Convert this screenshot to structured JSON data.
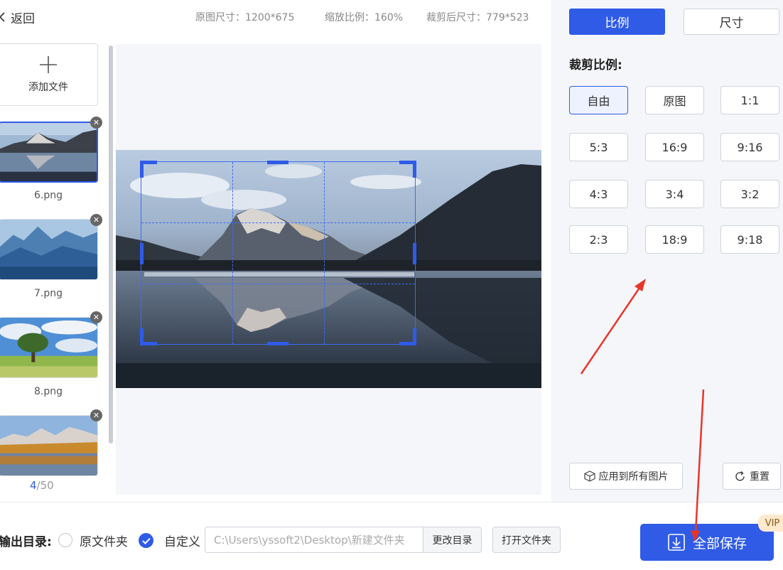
{
  "header": {
    "back_label": "返回",
    "original_size": "原图尺寸：1200*675",
    "zoom": "缩放比例：160%",
    "cropped_size": "裁剪后尺寸：779*523"
  },
  "files": {
    "add_label": "添加文件",
    "items": [
      {
        "name": "6.png",
        "active": true
      },
      {
        "name": "7.png",
        "active": false
      },
      {
        "name": "8.png",
        "active": false
      },
      {
        "name": "",
        "active": false
      }
    ],
    "counter_current": "4",
    "counter_total": "/50"
  },
  "panel": {
    "tab_ratio": "比例",
    "tab_size": "尺寸",
    "section_title": "裁剪比例:",
    "ratios": [
      "自由",
      "原图",
      "1:1",
      "5:3",
      "16:9",
      "9:16",
      "4:3",
      "3:4",
      "3:2",
      "2:3",
      "18:9",
      "9:18"
    ],
    "selected_ratio": "自由",
    "apply_all": "应用到所有图片",
    "reset": "重置"
  },
  "output": {
    "label": "输出目录:",
    "option_original": "原文件夹",
    "option_custom": "自定义",
    "selected": "custom",
    "path": "C:\\Users\\yssoft2\\Desktop\\新建文件夹",
    "change_dir": "更改目录",
    "open_folder": "打开文件夹",
    "save_all": "全部保存",
    "vip_badge": "VIP"
  },
  "colors": {
    "accent": "#2f5be7",
    "annotation_arrow": "#e8352b"
  }
}
